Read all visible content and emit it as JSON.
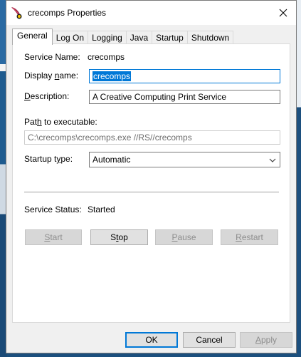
{
  "window": {
    "title": "crecomps Properties"
  },
  "tabs": [
    {
      "label": "General",
      "active": true
    },
    {
      "label": "Log On"
    },
    {
      "label": "Logging"
    },
    {
      "label": "Java"
    },
    {
      "label": "Startup"
    },
    {
      "label": "Shutdown"
    }
  ],
  "general": {
    "service_name_label": "Service Name:",
    "service_name_value": "crecomps",
    "display_name_label_pre": "Display ",
    "display_name_label_key": "n",
    "display_name_label_post": "ame:",
    "display_name_value": "crecomps",
    "description_label_key": "D",
    "description_label_post": "escription:",
    "description_value": "A Creative Computing Print Service",
    "path_label_pre": "Pat",
    "path_label_key": "h",
    "path_label_post": " to executable:",
    "path_value": "C:\\crecomps\\crecomps.exe //RS//crecomps",
    "startup_type_label_pre": "Startup t",
    "startup_type_label_key": "y",
    "startup_type_label_post": "pe:",
    "startup_type_value": "Automatic",
    "service_status_label": "Service Status:",
    "service_status_value": "Started"
  },
  "service_buttons": {
    "start_key": "S",
    "start_post": "tart",
    "stop_pre": "S",
    "stop_key": "t",
    "stop_post": "op",
    "pause_key": "P",
    "pause_post": "ause",
    "restart_key": "R",
    "restart_post": "estart"
  },
  "dialog_buttons": {
    "ok": "OK",
    "cancel": "Cancel",
    "apply_key": "A",
    "apply_post": "pply"
  },
  "colors": {
    "selection": "#0078d7",
    "desktop": "#1b4f7d"
  }
}
